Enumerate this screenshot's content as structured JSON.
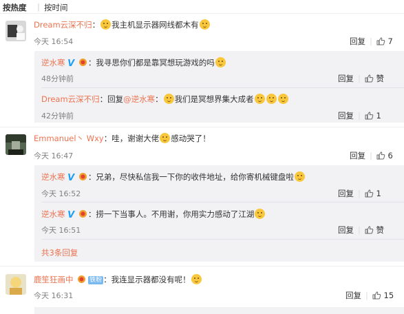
{
  "sort": {
    "hot": "按热度",
    "time": "按时间"
  },
  "comments": [
    {
      "user": "Dream云深不归",
      "text": "我主机显示器网线都木有",
      "time": "今天 16:54",
      "reply_label": "回复",
      "likes": "7",
      "replies": [
        {
          "user": "逆水寒",
          "verified": "V",
          "text": "我寻思你们都是靠冥想玩游戏的吗",
          "time": "48分钟前",
          "reply_label": "回复",
          "like_label": "赞"
        },
        {
          "user": "Dream云深不归",
          "text": "回复",
          "mention": "@逆水寒",
          "text2": "我们是冥想界集大成者",
          "time": "42分钟前",
          "reply_label": "回复",
          "likes": "1"
        }
      ]
    },
    {
      "user": "Emmanuel丶 Wxy",
      "text": "哇，谢谢大佬",
      "text2": "感动哭了！",
      "time": "今天 16:47",
      "reply_label": "回复",
      "likes": "6",
      "replies": [
        {
          "user": "逆水寒",
          "verified": "V",
          "text": "兄弟，尽快私信我一下你的收件地址，给你寄机械键盘啦",
          "time": "今天 16:52",
          "reply_label": "回复",
          "likes": "1"
        },
        {
          "user": "逆水寒",
          "verified": "V",
          "text": "捞一下当事人。不用谢，你用实力感动了江湖",
          "time": "今天 16:51",
          "reply_label": "回复",
          "like_label": "赞"
        }
      ],
      "more_replies": "共3条回复"
    },
    {
      "user": "鹿笙狂画中",
      "badge": "铁粉",
      "text": "我连显示器都没有呢！",
      "time": "今天 16:31",
      "reply_label": "回复",
      "likes": "15"
    }
  ],
  "colors": {
    "username": "#eb7350",
    "verified": "#1e9ff2",
    "subbox": "#f2f2f5"
  },
  "icons": [
    "thumbs-up-icon",
    "smile-emoji-icon",
    "medal-icon",
    "verified-v-icon"
  ]
}
